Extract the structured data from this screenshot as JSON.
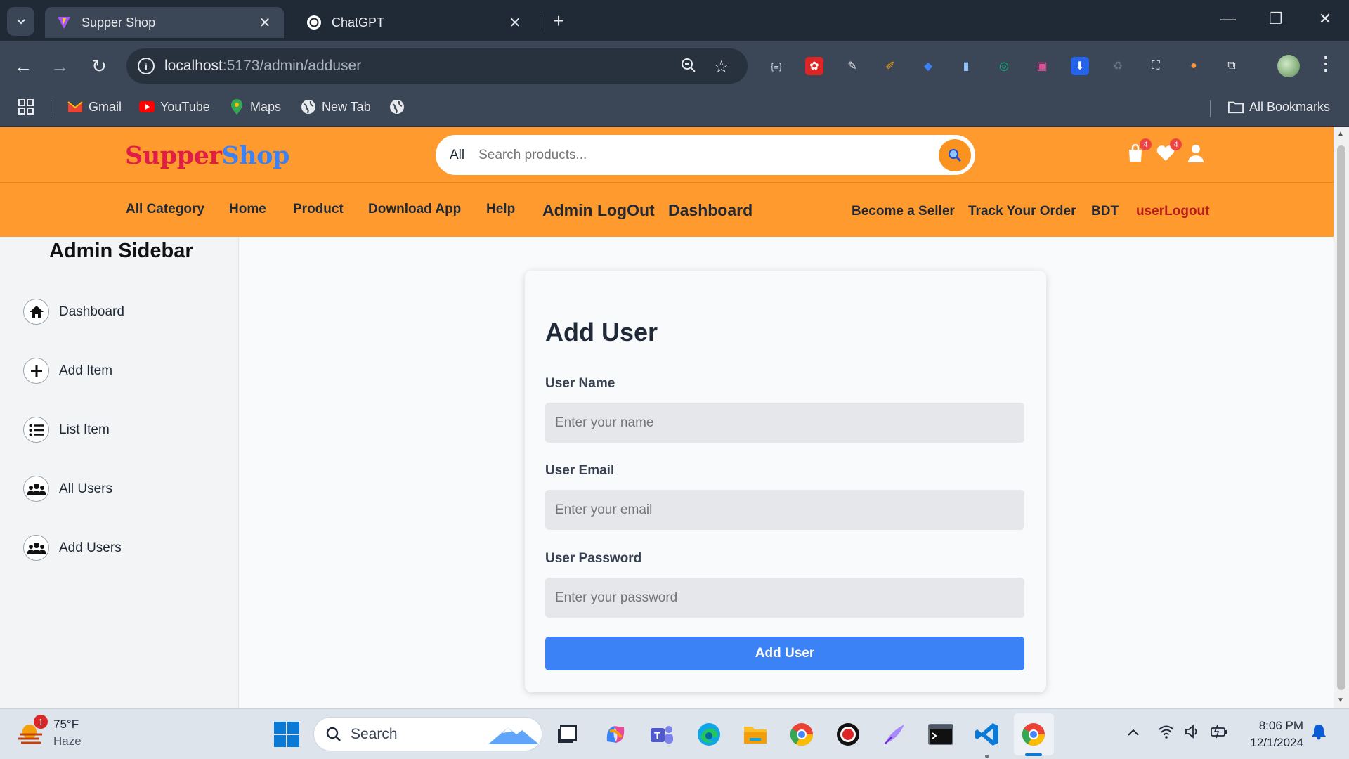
{
  "browser": {
    "tabs": [
      {
        "title": "Supper Shop",
        "active": true
      },
      {
        "title": "ChatGPT",
        "active": false
      }
    ],
    "url_host": "localhost",
    "url_rest": ":5173/admin/adduser",
    "bookmarks": [
      {
        "label": "Gmail",
        "icon": "gmail-icon"
      },
      {
        "label": "YouTube",
        "icon": "youtube-icon"
      },
      {
        "label": "Maps",
        "icon": "maps-icon"
      },
      {
        "label": "New Tab",
        "icon": "globe-icon"
      }
    ],
    "all_bookmarks": "All Bookmarks"
  },
  "site": {
    "logo_part1": "Supper",
    "logo_part2": "Shop",
    "search": {
      "category": "All",
      "placeholder": "Search products..."
    },
    "cart_count": "4",
    "wishlist_count": "4",
    "nav": {
      "all_category": "All Category",
      "home": "Home",
      "product": "Product",
      "download_app": "Download App",
      "help": "Help",
      "admin_logout": "Admin LogOut",
      "dashboard": "Dashboard",
      "become_seller": "Become a Seller",
      "track_order": "Track Your Order",
      "currency": "BDT",
      "user_logout": "userLogout"
    },
    "colors": {
      "header": "#ff9a2e",
      "logo_red": "#e11d48",
      "logo_blue": "#3b82f6",
      "primary_button": "#3b82f6"
    }
  },
  "sidebar": {
    "title": "Admin Sidebar",
    "items": [
      {
        "label": "Dashboard",
        "icon": "home-icon"
      },
      {
        "label": "Add Item",
        "icon": "plus-icon"
      },
      {
        "label": "List Item",
        "icon": "list-icon"
      },
      {
        "label": "All Users",
        "icon": "users-icon"
      },
      {
        "label": "Add Users",
        "icon": "users-icon"
      }
    ]
  },
  "form": {
    "title": "Add User",
    "name_label": "User Name",
    "name_placeholder": "Enter your name",
    "email_label": "User Email",
    "email_placeholder": "Enter your email",
    "password_label": "User Password",
    "password_placeholder": "Enter your password",
    "submit": "Add User"
  },
  "taskbar": {
    "weather_temp": "75°F",
    "weather_desc": "Haze",
    "weather_badge": "1",
    "search_label": "Search",
    "time": "8:06 PM",
    "date": "12/1/2024"
  }
}
